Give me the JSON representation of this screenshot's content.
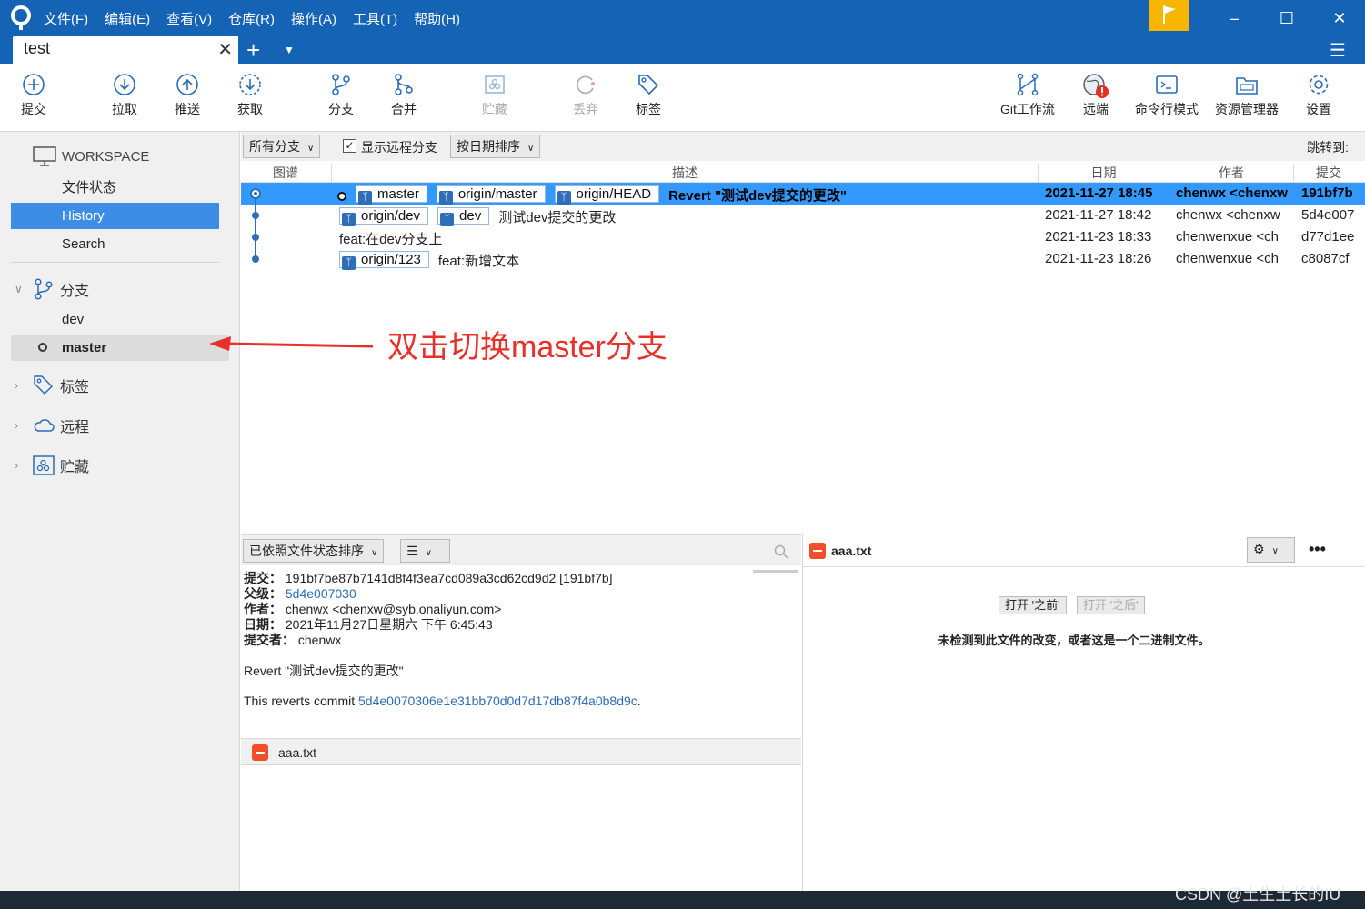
{
  "menu": [
    "文件(F)",
    "编辑(E)",
    "查看(V)",
    "仓库(R)",
    "操作(A)",
    "工具(T)",
    "帮助(H)"
  ],
  "tab": {
    "title": "test"
  },
  "toolbar": {
    "commit": "提交",
    "pull": "拉取",
    "push": "推送",
    "fetch": "获取",
    "branch": "分支",
    "merge": "合并",
    "stash": "贮藏",
    "discard": "丢弃",
    "tag": "标签",
    "gitflow": "Git工作流",
    "remote": "远端",
    "terminal": "命令行模式",
    "explorer": "资源管理器",
    "settings": "设置"
  },
  "sidebar": {
    "workspace": "WORKSPACE",
    "file_status": "文件状态",
    "history": "History",
    "search": "Search",
    "branches": "分支",
    "branch_items": [
      "dev",
      "master"
    ],
    "tags": "标签",
    "remotes": "远程",
    "stashes": "贮藏"
  },
  "filterbar": {
    "branches_filter": "所有分支",
    "show_remote": "显示远程分支",
    "sort": "按日期排序",
    "jump_to": "跳转到:"
  },
  "columns": {
    "graph": "图谱",
    "desc": "描述",
    "date": "日期",
    "author": "作者",
    "commit": "提交"
  },
  "commits": [
    {
      "refs": [
        "master",
        "origin/master",
        "origin/HEAD"
      ],
      "message": "Revert \"测试dev提交的更改\"",
      "date": "2021-11-27 18:45",
      "author": "chenwx <chenxw",
      "hash": "191bf7b"
    },
    {
      "refs": [
        "origin/dev",
        "dev"
      ],
      "message": "测试dev提交的更改",
      "date": "2021-11-27 18:42",
      "author": "chenwx <chenxw",
      "hash": "5d4e007"
    },
    {
      "refs": [],
      "message": "feat:在dev分支上",
      "date": "2021-11-23 18:33",
      "author": "chenwenxue <ch",
      "hash": "d77d1ee"
    },
    {
      "refs": [
        "origin/123"
      ],
      "message": "feat:新增文本",
      "date": "2021-11-23 18:26",
      "author": "chenwenxue <ch",
      "hash": "c8087cf"
    }
  ],
  "details": {
    "sort_label": "已依照文件状态排序",
    "commit_label": "提交：",
    "commit_value": "191bf7be87b7141d8f4f3ea7cd089a3cd62cd9d2 [191bf7b]",
    "parent_label": "父级：",
    "parent_value": "5d4e007030",
    "author_label": "作者：",
    "author_value": "chenwx <chenxw@syb.onaliyun.com>",
    "date_label": "日期：",
    "date_value": "2021年11月27日星期六 下午 6:45:43",
    "committer_label": "提交者：",
    "committer_value": "chenwx",
    "msg1": "Revert \"测试dev提交的更改\"",
    "msg2_prefix": "This reverts commit ",
    "msg2_hash": "5d4e0070306e1e31bb70d0d7d17db87f4a0b8d9c",
    "msg2_suffix": ".",
    "file": "aaa.txt"
  },
  "diff": {
    "file": "aaa.txt",
    "open_before": "打开 '之前'",
    "open_after": "打开 '之后'",
    "message": "未检测到此文件的改变，或者这是一个二进制文件。"
  },
  "annotation": "双击切换master分支",
  "watermark": "CSDN @土生土长的IU",
  "colors": {
    "titlebar": "#1463b5",
    "selection": "#3399ff",
    "annotation": "#e8302a"
  }
}
